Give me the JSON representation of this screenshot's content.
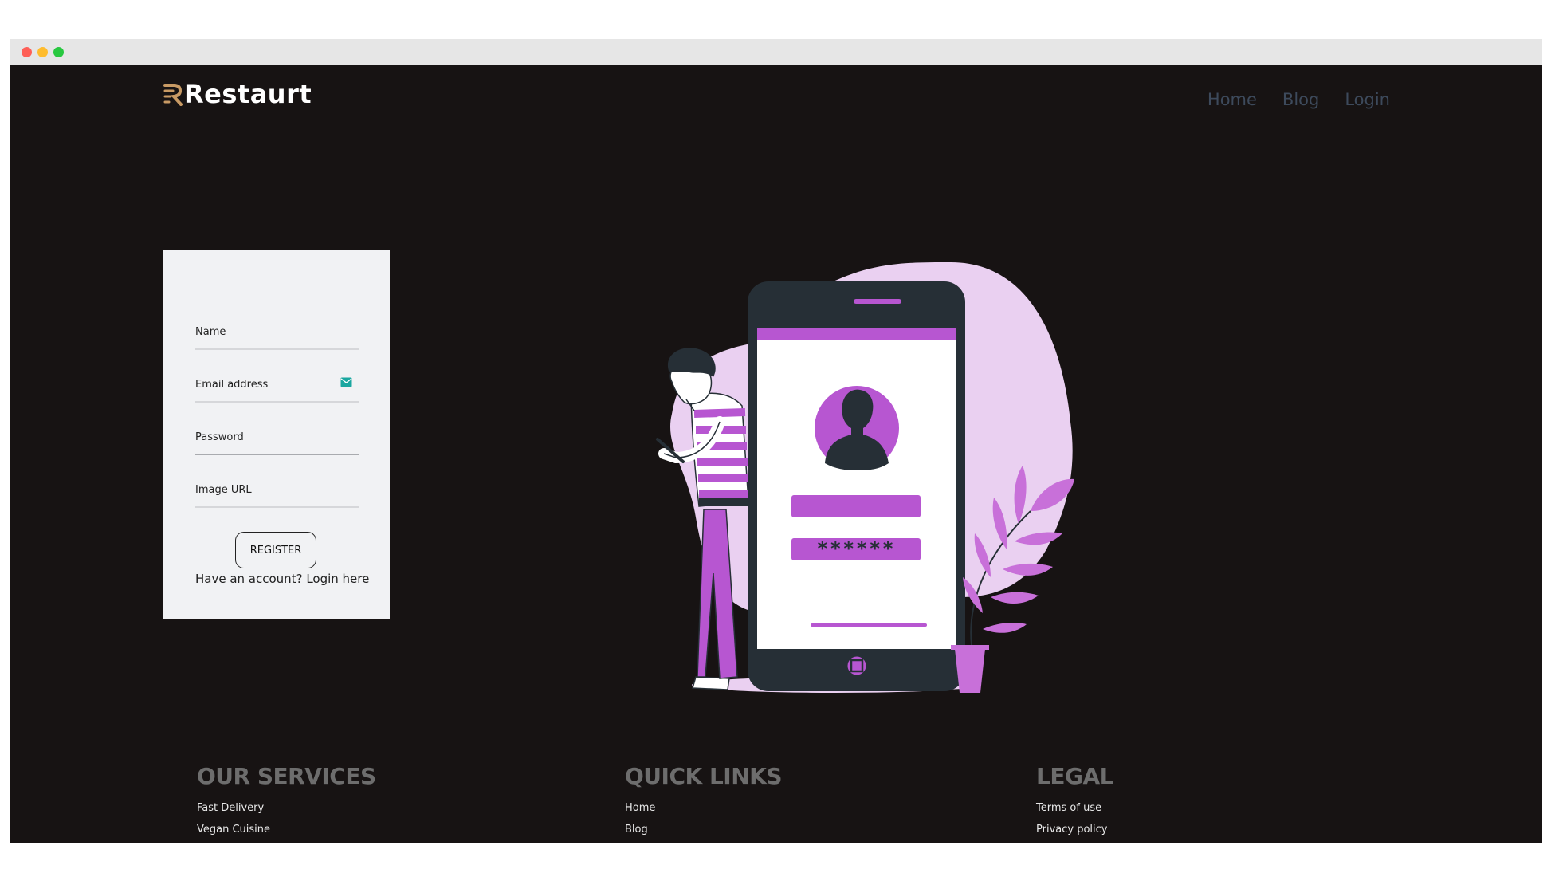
{
  "brand": {
    "name": "Restaurt",
    "logo_icon": "restaurant-r-mark-icon",
    "accent": "#c89a64"
  },
  "nav": {
    "items": [
      "Home",
      "Blog",
      "Login"
    ]
  },
  "form": {
    "fields": {
      "name": "Name",
      "email": "Email address",
      "password": "Password",
      "image_url": "Image URL"
    },
    "email_icon": "envelope-icon",
    "register_label": "REGISTER",
    "account_prompt": "Have an account?",
    "login_link": "Login here"
  },
  "illustration": {
    "description_icon": "login-phone-illustration",
    "password_mask": "******",
    "accent": "#b756d1"
  },
  "footer": {
    "services": {
      "title": "OUR SERVICES",
      "items": [
        "Fast Delivery",
        "Vegan Cuisine"
      ]
    },
    "quick_links": {
      "title": "QUICK LINKS",
      "items": [
        "Home",
        "Blog"
      ]
    },
    "legal": {
      "title": "LEGAL",
      "items": [
        "Terms of use",
        "Privacy policy"
      ]
    }
  },
  "colors": {
    "background": "#171313",
    "card": "#f1f2f4",
    "nav_text": "#3d4a5c",
    "purple": "#b756d1",
    "light_purple": "#ead0f1"
  }
}
